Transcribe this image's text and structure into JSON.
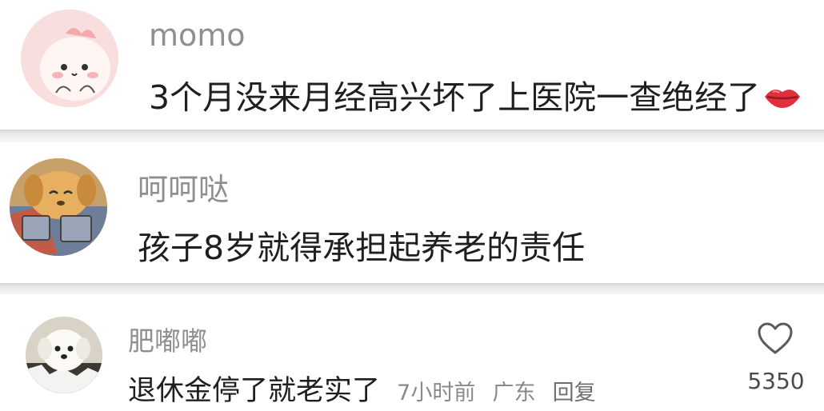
{
  "comments": [
    {
      "username": "momo",
      "text": "3个月没来月经高兴坏了上医院一查绝经了",
      "emoji_icon": "lips-emoji-icon"
    },
    {
      "username": "呵呵哒",
      "text": "孩子8岁就得承担起养老的责任"
    },
    {
      "username": "肥嘟嘟",
      "text": "退休金停了就老实了",
      "time": "7小时前",
      "location": "广东",
      "reply_label": "回复",
      "like_icon": "heart-outline-icon",
      "like_count": "5350"
    }
  ],
  "colors": {
    "username": "#8f8f8f",
    "text": "#1f1f1f",
    "meta": "#8a8a8a",
    "divider": "#e6e6e6"
  }
}
